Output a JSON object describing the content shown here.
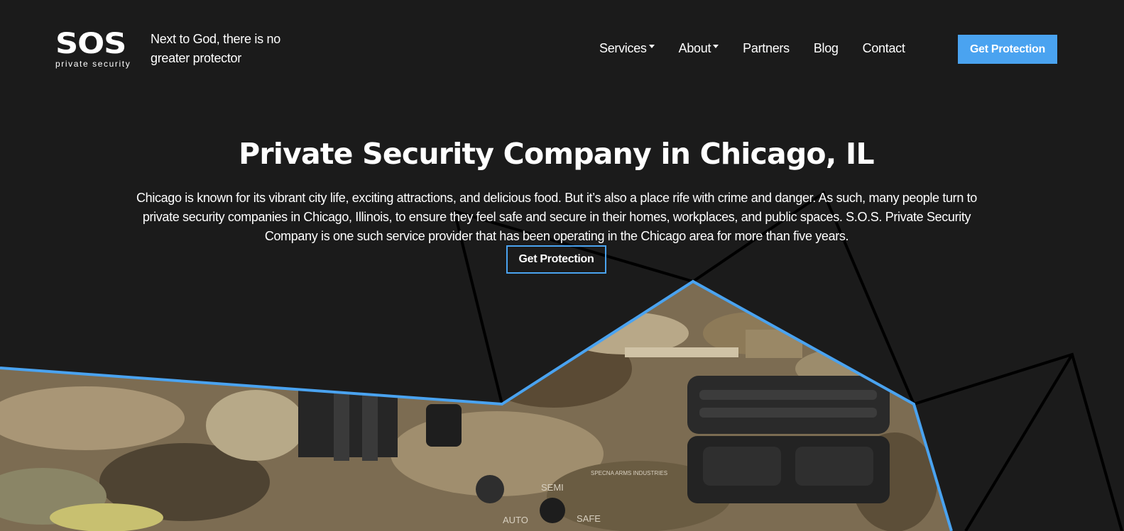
{
  "header": {
    "logo_text": "SOS",
    "logo_subtext": "private security",
    "tagline": "Next to God, there is no greater protector",
    "nav": [
      {
        "label": "Services",
        "has_dropdown": true
      },
      {
        "label": "About",
        "has_dropdown": true
      },
      {
        "label": "Partners",
        "has_dropdown": false
      },
      {
        "label": "Blog",
        "has_dropdown": false
      },
      {
        "label": "Contact",
        "has_dropdown": false
      }
    ],
    "cta_label": "Get Protection"
  },
  "hero": {
    "title": "Private Security Company in Chicago, IL",
    "description": "Chicago is known for its vibrant city life, exciting attractions, and delicious food. But it’s also a place rife with crime and danger. As such, many people turn to private security companies in Chicago, Illinois, to ensure they feel safe and secure in their homes, workplaces, and public spaces. S.O.S. Private Security Company is one such service provider that has been operating in the Chicago area for more than five years.",
    "cta_label": "Get Protection",
    "image_markings": [
      "SEMI",
      "AUTO",
      "SAFE",
      "SPECNA ARMS INDUSTRIES"
    ]
  },
  "colors": {
    "background": "#1b1b1b",
    "accent": "#4aa3f0",
    "text": "#ffffff",
    "camo_tan": "#8c7a5c",
    "camo_brown": "#5e4d36",
    "camo_olive": "#6b6a48",
    "metal": "#2a2a2a"
  }
}
